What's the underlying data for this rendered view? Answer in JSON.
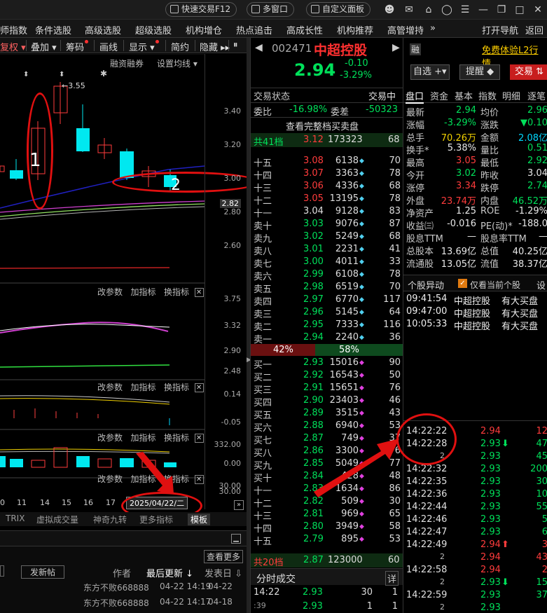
{
  "titlebar": {
    "quick_trade": "快速交易F12",
    "multi_window": "多窗口",
    "custom_panel": "自定义面板"
  },
  "menubar": {
    "items": [
      "师指数",
      "条件选股",
      "高级选股",
      "超级选股",
      "机构增仓",
      "热点追击",
      "高成长性",
      "机构推荐",
      "高管增持",
      "»"
    ],
    "open_nav": "打开导航",
    "back": "返回"
  },
  "chart_toolbar": {
    "items": [
      "复权",
      "叠加",
      "筹码",
      "画线",
      "显示",
      "简约",
      "隐藏"
    ],
    "margin": "融资融券",
    "settings_ma": "设置均线"
  },
  "kline": {
    "high_label": "3.55",
    "axis": [
      "3.40",
      "3.20",
      "3.00",
      "2.82",
      "2.80",
      "2.60"
    ],
    "annotation_1": "1",
    "annotation_2": "2"
  },
  "sub1": {
    "axis": [
      "3.75",
      "3.32",
      "2.90",
      "2.48"
    ],
    "actions": [
      "改参数",
      "加指标",
      "换指标"
    ]
  },
  "sub2": {
    "axis": [
      "0.14",
      "-0.05"
    ],
    "actions": [
      "改参数",
      "加指标",
      "换指标"
    ]
  },
  "sub3": {
    "axis": [
      "332.00",
      "0.00"
    ],
    "actions": [
      "改参数",
      "加指标",
      "换指标"
    ]
  },
  "sub4": {
    "axis": [
      "30.00",
      "30.00"
    ],
    "actions": [
      "改参数",
      "加指标",
      "换指标"
    ]
  },
  "xaxis": {
    "ticks": [
      "0",
      "11",
      "14",
      "15",
      "16",
      "17"
    ],
    "date": "2025/04/22/二"
  },
  "bottom_tabs": [
    "TRIX",
    "虚拟成交量",
    "神奇九转",
    "更多指标",
    "模板"
  ],
  "forum": {
    "new_post": "发新帖",
    "view_more": "查看更多",
    "col_author": "作者",
    "col_last_update": "最后更新",
    "col_published": "发表日",
    "rows": [
      {
        "author": "东方不败668888",
        "updated": "04-22 14:19",
        "published": "04-22"
      },
      {
        "author": "东方不败668888",
        "updated": "04-22 14:17",
        "published": "04-18"
      }
    ]
  },
  "stock": {
    "code": "002471",
    "name": "中超控股",
    "price": "2.94",
    "change": "-0.10",
    "change_pct": "-3.29%",
    "rong": "融"
  },
  "trade_status": {
    "label": "交易状态",
    "value": "交易中"
  },
  "weibi": {
    "label": "委比",
    "value": "-16.98%",
    "label2": "委差",
    "value2": "-50323"
  },
  "full_book": "查看完整档买卖盘",
  "sell_total": {
    "label": "共41档",
    "price": "3.12",
    "vol": "173323",
    "n": "68"
  },
  "asks": [
    {
      "lbl": "十五",
      "p": "3.08",
      "v": "6138",
      "n": "70"
    },
    {
      "lbl": "十四",
      "p": "3.07",
      "v": "3363",
      "n": "78"
    },
    {
      "lbl": "十三",
      "p": "3.06",
      "v": "4336",
      "n": "68"
    },
    {
      "lbl": "十二",
      "p": "3.05",
      "v": "13195",
      "n": "78"
    },
    {
      "lbl": "十一",
      "p": "3.04",
      "v": "9128",
      "n": "83"
    },
    {
      "lbl": "卖十",
      "p": "3.03",
      "v": "9076",
      "n": "87"
    },
    {
      "lbl": "卖九",
      "p": "3.02",
      "v": "5249",
      "n": "68"
    },
    {
      "lbl": "卖八",
      "p": "3.01",
      "v": "2231",
      "n": "41"
    },
    {
      "lbl": "卖七",
      "p": "3.00",
      "v": "4011",
      "n": "33"
    },
    {
      "lbl": "卖六",
      "p": "2.99",
      "v": "6108",
      "n": "78"
    },
    {
      "lbl": "卖五",
      "p": "2.98",
      "v": "6519",
      "n": "70"
    },
    {
      "lbl": "卖四",
      "p": "2.97",
      "v": "6770",
      "n": "117"
    },
    {
      "lbl": "卖三",
      "p": "2.96",
      "v": "5145",
      "n": "64"
    },
    {
      "lbl": "卖二",
      "p": "2.95",
      "v": "7333",
      "n": "116"
    },
    {
      "lbl": "卖一",
      "p": "2.94",
      "v": "2240",
      "n": "36"
    }
  ],
  "ratio": {
    "sell": "42%",
    "buy": "58%"
  },
  "bids": [
    {
      "lbl": "买一",
      "p": "2.93",
      "v": "15016",
      "n": "90"
    },
    {
      "lbl": "买二",
      "p": "2.92",
      "v": "16543",
      "n": "50"
    },
    {
      "lbl": "买三",
      "p": "2.91",
      "v": "15651",
      "n": "76"
    },
    {
      "lbl": "买四",
      "p": "2.90",
      "v": "23403",
      "n": "46"
    },
    {
      "lbl": "买五",
      "p": "2.89",
      "v": "3515",
      "n": "43"
    },
    {
      "lbl": "买六",
      "p": "2.88",
      "v": "6940",
      "n": "53"
    },
    {
      "lbl": "买七",
      "p": "2.87",
      "v": "749",
      "n": "37"
    },
    {
      "lbl": "买八",
      "p": "2.86",
      "v": "3300",
      "n": "76"
    },
    {
      "lbl": "买九",
      "p": "2.85",
      "v": "5049",
      "n": "77"
    },
    {
      "lbl": "买十",
      "p": "2.84",
      "v": "428",
      "n": "48"
    },
    {
      "lbl": "十一",
      "p": "2.83",
      "v": "1634",
      "n": "86"
    },
    {
      "lbl": "十二",
      "p": "2.82",
      "v": "509",
      "n": "30"
    },
    {
      "lbl": "十三",
      "p": "2.81",
      "v": "969",
      "n": "65"
    },
    {
      "lbl": "十四",
      "p": "2.80",
      "v": "3949",
      "n": "58"
    },
    {
      "lbl": "十五",
      "p": "2.79",
      "v": "895",
      "n": "53"
    }
  ],
  "buy_total": {
    "label": "共20档",
    "price": "2.87",
    "vol": "123000",
    "n": "60"
  },
  "tick_header": {
    "label": "分时成交",
    "detail": "详"
  },
  "mid_ticks": [
    {
      "t": "14:22",
      "p": "2.93",
      "v": "30",
      "n": "1"
    },
    {
      "t": ":39",
      "p": "2.93",
      "v": "1",
      "n": "1"
    }
  ],
  "right": {
    "trial": "免费体验L2行情",
    "zixuan": "自选",
    "remind": "提醒",
    "trade": "交易",
    "tabs": [
      "盘口",
      "资金",
      "基本",
      "指数",
      "明细",
      "逐笔"
    ],
    "quote_rows": [
      {
        "l1": "最新",
        "v1": "2.94",
        "c1": "green",
        "l2": "均价",
        "v2": "2.96",
        "c2": "green"
      },
      {
        "l1": "涨幅",
        "v1": "-3.29%",
        "c1": "green",
        "l2": "涨跌",
        "v2": "▼0.10",
        "c2": "green"
      },
      {
        "l1": "总手",
        "v1": "70.26万",
        "c1": "yellow",
        "l2": "金额",
        "v2": "2.08亿",
        "c2": "cyan"
      },
      {
        "l1": "换手*",
        "v1": "5.38%",
        "c1": "white",
        "l2": "量比",
        "v2": "0.51",
        "c2": "green"
      },
      {
        "l1": "最高",
        "v1": "3.05",
        "c1": "red",
        "l2": "最低",
        "v2": "2.92",
        "c2": "green"
      },
      {
        "l1": "今开",
        "v1": "3.02",
        "c1": "green",
        "l2": "昨收",
        "v2": "3.04",
        "c2": "white"
      },
      {
        "l1": "涨停",
        "v1": "3.34",
        "c1": "red",
        "l2": "跌停",
        "v2": "2.74",
        "c2": "green"
      },
      {
        "l1": "外盘",
        "v1": "23.74万",
        "c1": "red",
        "l2": "内盘",
        "v2": "46.52万",
        "c2": "green"
      },
      {
        "l1": "净资产",
        "v1": "1.25",
        "c1": "white",
        "l2": "ROE",
        "v2": "-1.29%",
        "c2": "white"
      },
      {
        "l1": "收益㈢",
        "v1": "-0.016",
        "c1": "white",
        "l2": "PE(动)*",
        "v2": "-188.0",
        "c2": "white"
      },
      {
        "l1": "股息TTM",
        "v1": "—",
        "c1": "white",
        "l2": "股息率TTM",
        "v2": "—",
        "c2": "white"
      },
      {
        "l1": "总股本",
        "v1": "13.69亿",
        "c1": "white",
        "l2": "总值",
        "v2": "40.25亿",
        "c2": "white"
      },
      {
        "l1": "流通股",
        "v1": "13.05亿",
        "c1": "white",
        "l2": "流值",
        "v2": "38.37亿",
        "c2": "white"
      }
    ],
    "movement": {
      "title": "个股异动",
      "only_current": "仅看当前个股",
      "settings": "设"
    },
    "events": [
      {
        "t": "09:41:54",
        "name": "中超控股",
        "desc": "有大买盘"
      },
      {
        "t": "09:47:00",
        "name": "中超控股",
        "desc": "有大买盘"
      },
      {
        "t": "10:05:33",
        "name": "中超控股",
        "desc": "有大买盘"
      }
    ],
    "ticks": [
      {
        "t": "14:22:22",
        "p": "2.94",
        "a": "",
        "v": "12",
        "c": "red"
      },
      {
        "t": "14:22:28",
        "p": "2.93",
        "a": "⬇",
        "v": "47",
        "c": "green"
      },
      {
        "t": "2",
        "p": "2.93",
        "a": "",
        "v": "45",
        "c": "green"
      },
      {
        "t": "14:22:32",
        "p": "2.93",
        "a": "",
        "v": "200",
        "c": "green"
      },
      {
        "t": "14:22:35",
        "p": "2.93",
        "a": "",
        "v": "30",
        "c": "green"
      },
      {
        "t": "14:22:36",
        "p": "2.93",
        "a": "",
        "v": "10",
        "c": "green"
      },
      {
        "t": "14:22:44",
        "p": "2.93",
        "a": "",
        "v": "55",
        "c": "green"
      },
      {
        "t": "14:22:46",
        "p": "2.93",
        "a": "",
        "v": "5",
        "c": "green"
      },
      {
        "t": "14:22:47",
        "p": "2.93",
        "a": "",
        "v": "6",
        "c": "green"
      },
      {
        "t": "14:22:49",
        "p": "2.94",
        "a": "⬆",
        "v": "3",
        "c": "red"
      },
      {
        "t": "2",
        "p": "2.94",
        "a": "",
        "v": "43",
        "c": "red"
      },
      {
        "t": "14:22:58",
        "p": "2.94",
        "a": "",
        "v": "2",
        "c": "red"
      },
      {
        "t": "2",
        "p": "2.93",
        "a": "⬇",
        "v": "15",
        "c": "green"
      },
      {
        "t": "14:22:59",
        "p": "2.93",
        "a": "",
        "v": "37",
        "c": "green"
      },
      {
        "t": "2",
        "p": "2.93",
        "a": "",
        "v": "",
        "c": "green"
      }
    ]
  }
}
